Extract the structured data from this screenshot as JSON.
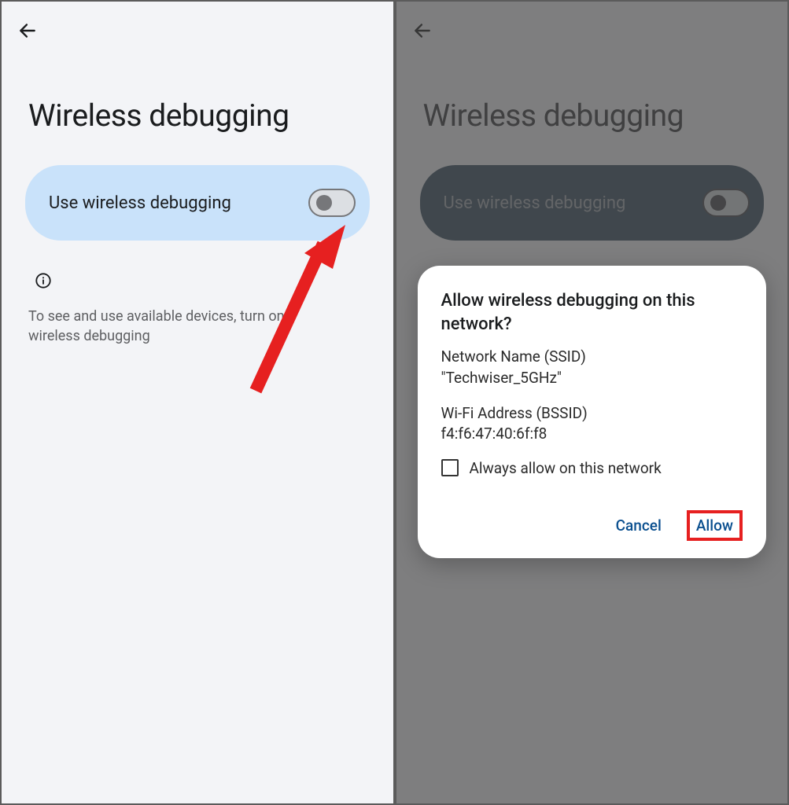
{
  "left": {
    "page_title": "Wireless debugging",
    "toggle": {
      "label": "Use wireless debugging",
      "state": "off"
    },
    "info_text": "To see and use available devices, turn on wireless debugging"
  },
  "right": {
    "page_title": "Wireless debugging",
    "toggle": {
      "label": "Use wireless debugging",
      "state": "off"
    },
    "dialog": {
      "title": "Allow wireless debugging on this network?",
      "ssid_label": "Network Name (SSID)",
      "ssid_value": "\"Techwiser_5GHz\"",
      "bssid_label": "Wi-Fi Address (BSSID)",
      "bssid_value": "f4:f6:47:40:6f:f8",
      "checkbox_label": "Always allow on this network",
      "checkbox_checked": false,
      "cancel_label": "Cancel",
      "allow_label": "Allow"
    }
  },
  "annotations": {
    "arrow_points_to": "toggle",
    "highlight_on": "allow-button"
  }
}
